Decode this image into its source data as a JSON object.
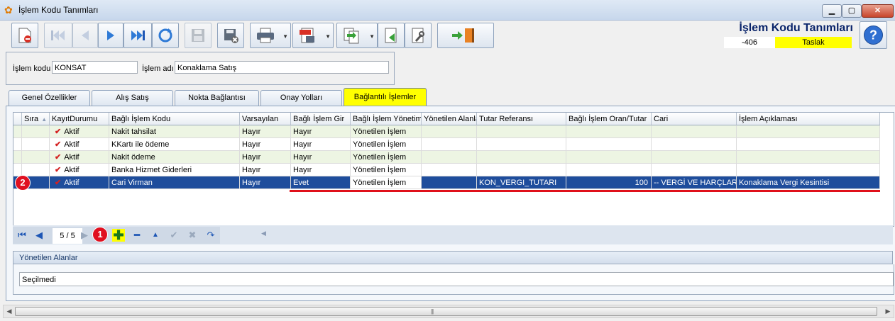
{
  "window": {
    "title": "İşlem Kodu Tanımları"
  },
  "header": {
    "title": "İşlem Kodu Tanımları",
    "record_number": "-406",
    "status": "Taslak"
  },
  "form": {
    "code_label": "İşlem kodu",
    "code_value": "KONSAT",
    "name_label": "İşlem adı",
    "name_value": "Konaklama Satış"
  },
  "tabs": [
    {
      "label": "Genel Özellikler"
    },
    {
      "label": "Alış Satış"
    },
    {
      "label": "Nokta Bağlantısı"
    },
    {
      "label": "Onay Yolları"
    },
    {
      "label": "Bağlantılı İşlemler",
      "active": true
    }
  ],
  "grid": {
    "columns": [
      "Sıra",
      "KayıtDurumu",
      "Bağlı İşlem Kodu",
      "Varsayılan",
      "Bağlı İşlem Gir",
      "Bağlı İşlem Yönetimi",
      "Yönetilen Alanlar",
      "Tutar Referansı",
      "Bağlı İşlem Oran/Tutar",
      "Cari",
      "İşlem Açıklaması"
    ],
    "rows": [
      {
        "status": "Aktif",
        "code": "Nakit tahsilat",
        "default": "Hayır",
        "enter": "Hayır",
        "management": "Yönetilen İşlem",
        "fields": "",
        "amount_ref": "",
        "rate": "",
        "account": "",
        "description": ""
      },
      {
        "status": "Aktif",
        "code": "KKartı ile ödeme",
        "default": "Hayır",
        "enter": "Hayır",
        "management": "Yönetilen İşlem",
        "fields": "",
        "amount_ref": "",
        "rate": "",
        "account": "",
        "description": ""
      },
      {
        "status": "Aktif",
        "code": "Nakit ödeme",
        "default": "Hayır",
        "enter": "Hayır",
        "management": "Yönetilen İşlem",
        "fields": "",
        "amount_ref": "",
        "rate": "",
        "account": "",
        "description": ""
      },
      {
        "status": "Aktif",
        "code": "Banka Hizmet Giderleri",
        "default": "Hayır",
        "enter": "Hayır",
        "management": "Yönetilen İşlem",
        "fields": "",
        "amount_ref": "",
        "rate": "",
        "account": "",
        "description": ""
      },
      {
        "status": "Aktif",
        "code": "Cari Virman",
        "default": "Hayır",
        "enter": "Evet",
        "management": "Yönetilen İşlem",
        "fields": "",
        "amount_ref": "KON_VERGI_TUTARI",
        "rate": "100",
        "account": "-- VERGİ VE HARÇLAR --",
        "description": "Konaklama Vergi Kesintisi",
        "selected": true
      }
    ]
  },
  "navigator": {
    "pager": "5 / 5"
  },
  "callouts": {
    "one": "1",
    "two": "2"
  },
  "managed_fields": {
    "header": "Yönetilen Alanlar",
    "value": "Seçilmedi"
  },
  "colors": {
    "accent": "#1e4d9c",
    "highlight": "#ffff00",
    "callout": "#e01020"
  }
}
